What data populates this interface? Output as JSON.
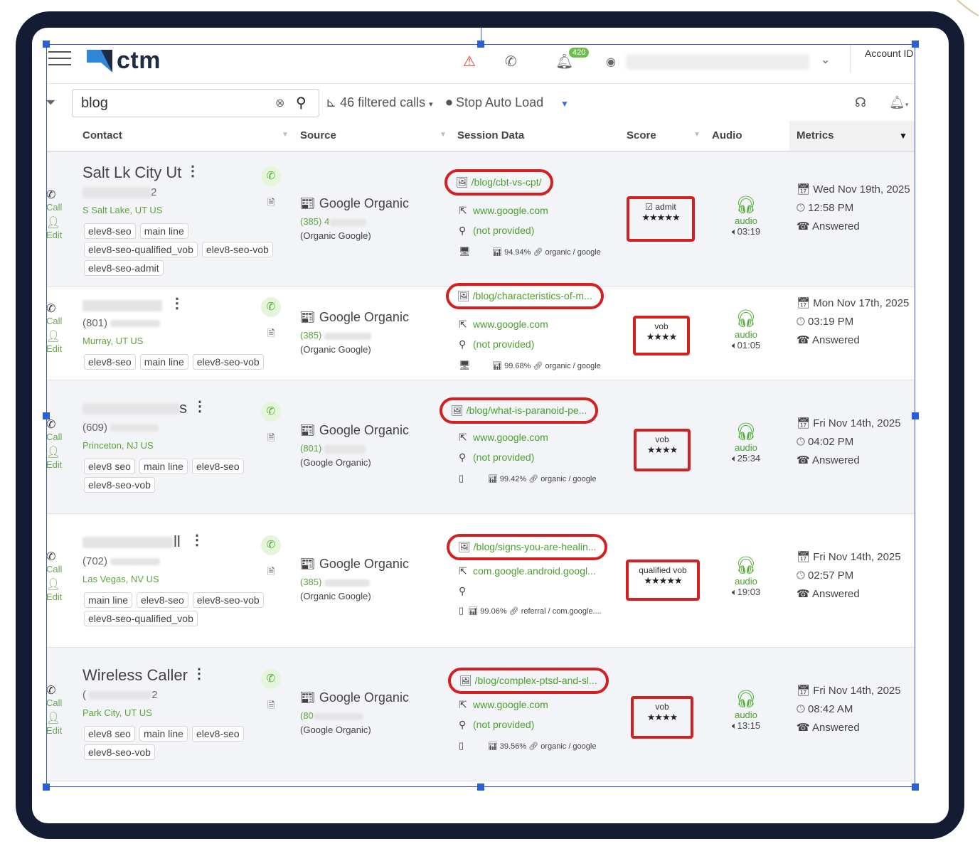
{
  "header": {
    "logo_text": "ctm",
    "notification_count": "420",
    "account_label": "Account ID"
  },
  "toolbar": {
    "search_value": "blog",
    "filtered_calls": "46 filtered calls",
    "stop_auto_load": "Stop Auto Load"
  },
  "columns": {
    "contact": "Contact",
    "source": "Source",
    "session": "Session Data",
    "score": "Score",
    "audio": "Audio",
    "metrics": "Metrics"
  },
  "side": {
    "call": "Call",
    "edit": "Edit"
  },
  "rows": [
    {
      "name": "Salt Lk City Ut",
      "phone": "2",
      "location": "S Salt Lake, UT US",
      "tags": [
        "elev8-seo",
        "main line",
        "elev8-seo-qualified_vob",
        "elev8-seo-vob",
        "elev8-seo-admit"
      ],
      "source": "Google Organic",
      "source_num": "(385) 4",
      "source_sub": "(Organic Google)",
      "page": "/blog/cbt-vs-cpt/",
      "referrer": "www.google.com",
      "location_data": "(not provided)",
      "metric_pct": "94.94%",
      "metric_src": "organic / google",
      "score_label": "admit",
      "stars": "★★★★★",
      "audio_label": "audio",
      "duration": "03:19",
      "date": "Wed Nov 19th, 2025",
      "time": "12:58 PM",
      "status": "Answered"
    },
    {
      "name": "",
      "phone": "(801)",
      "location": "Murray, UT US",
      "tags": [
        "elev8-seo",
        "main line",
        "elev8-seo-vob"
      ],
      "source": "Google Organic",
      "source_num": "(385)",
      "source_sub": "(Organic Google)",
      "page": "/blog/characteristics-of-m...",
      "referrer": "www.google.com",
      "location_data": "(not provided)",
      "metric_pct": "99.68%",
      "metric_src": "organic / google",
      "score_label": "vob",
      "stars": "★★★★",
      "audio_label": "audio",
      "duration": "01:05",
      "date": "Mon Nov 17th, 2025",
      "time": "03:19 PM",
      "status": "Answered"
    },
    {
      "name": "s",
      "phone": "(609)",
      "location": "Princeton, NJ US",
      "tags": [
        "elev8 seo",
        "main line",
        "elev8-seo",
        "elev8-seo-vob"
      ],
      "source": "Google Organic",
      "source_num": "(801)",
      "source_sub": "(Google Organic)",
      "page": "/blog/what-is-paranoid-pe...",
      "referrer": "www.google.com",
      "location_data": "(not provided)",
      "metric_pct": "99.42%",
      "metric_src": "organic / google",
      "score_label": "vob",
      "stars": "★★★★",
      "audio_label": "audio",
      "duration": "25:34",
      "date": "Fri Nov 14th, 2025",
      "time": "04:02 PM",
      "status": "Answered"
    },
    {
      "name": "ll",
      "phone": "(702)",
      "location": "Las Vegas, NV US",
      "tags": [
        "main line",
        "elev8-seo",
        "elev8-seo-vob",
        "elev8-seo-qualified_vob"
      ],
      "source": "Google Organic",
      "source_num": "(385)",
      "source_sub": "(Organic Google)",
      "page": "/blog/signs-you-are-healin...",
      "referrer": "com.google.android.googl...",
      "location_data": "",
      "metric_pct": "99.06%",
      "metric_src": "referral / com.google....",
      "score_label": "qualified vob",
      "stars": "★★★★★",
      "audio_label": "audio",
      "duration": "19:03",
      "date": "Fri Nov 14th, 2025",
      "time": "02:57 PM",
      "status": "Answered"
    },
    {
      "name": "Wireless Caller",
      "phone": "2",
      "location": "Park City, UT US",
      "tags": [
        "elev8 seo",
        "main line",
        "elev8-seo",
        "elev8-seo-vob"
      ],
      "source": "Google Organic",
      "source_num": "(80",
      "source_sub": "(Google Organic)",
      "page": "/blog/complex-ptsd-and-sl...",
      "referrer": "www.google.com",
      "location_data": "(not provided)",
      "metric_pct": "39.56%",
      "metric_src": "organic / google",
      "score_label": "vob",
      "stars": "★★★★",
      "audio_label": "audio",
      "duration": "13:15",
      "date": "Fri Nov 14th, 2025",
      "time": "08:42 AM",
      "status": "Answered"
    }
  ],
  "colors": {
    "accent_green": "#4aa02c",
    "highlight_red": "#d32020",
    "frame": "#131c33"
  }
}
